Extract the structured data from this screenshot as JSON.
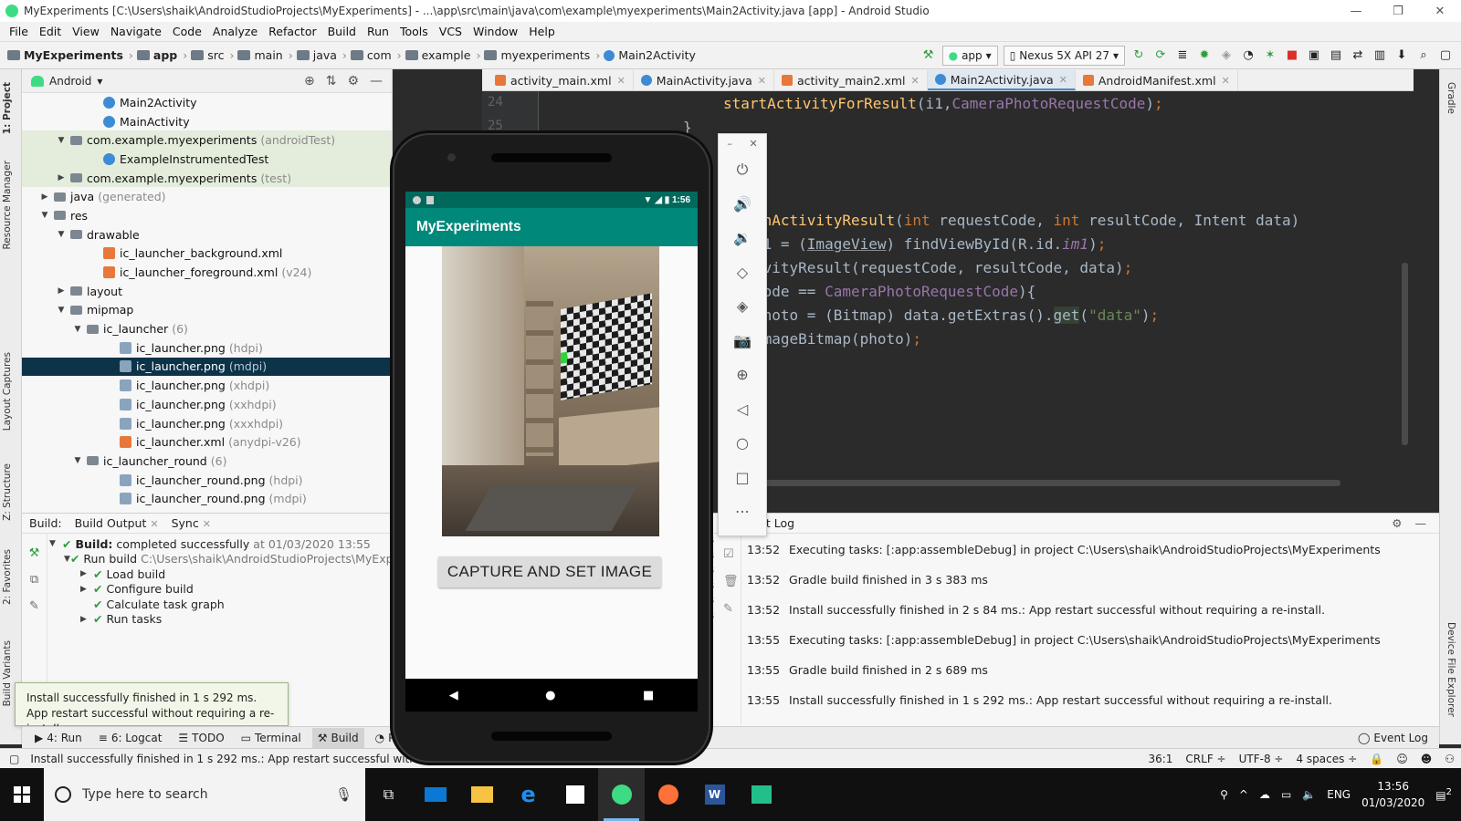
{
  "window": {
    "title": "MyExperiments [C:\\Users\\shaik\\AndroidStudioProjects\\MyExperiments] - ...\\app\\src\\main\\java\\com\\example\\myexperiments\\Main2Activity.java [app] - Android Studio",
    "controls": [
      "—",
      "❐",
      "✕"
    ]
  },
  "menu": [
    "File",
    "Edit",
    "View",
    "Navigate",
    "Code",
    "Analyze",
    "Refactor",
    "Build",
    "Run",
    "Tools",
    "VCS",
    "Window",
    "Help"
  ],
  "breadcrumbs": [
    "MyExperiments",
    "app",
    "src",
    "main",
    "java",
    "com",
    "example",
    "myexperiments",
    "Main2Activity"
  ],
  "toolbar": {
    "run_config": "app",
    "device": "Nexus 5X API 27"
  },
  "left_strip": [
    "1: Project",
    "Resource Manager",
    "Layout Captures",
    "Z: Structure",
    "2: Favorites",
    "Build Variants"
  ],
  "right_strip": [
    "Gradle",
    "Device File Explorer"
  ],
  "project": {
    "view_label": "Android",
    "rows": [
      {
        "indent": 4,
        "arrow": "",
        "icon": "cls",
        "name": "Main2Activity",
        "dim": "",
        "hl": false,
        "sel": false
      },
      {
        "indent": 4,
        "arrow": "",
        "icon": "cls",
        "name": "MainActivity",
        "dim": "",
        "hl": false,
        "sel": false
      },
      {
        "indent": 2,
        "arrow": "▼",
        "icon": "fold",
        "name": "com.example.myexperiments",
        "dim": "(androidTest)",
        "hl": true,
        "sel": false
      },
      {
        "indent": 4,
        "arrow": "",
        "icon": "cls",
        "name": "ExampleInstrumentedTest",
        "dim": "",
        "hl": true,
        "sel": false
      },
      {
        "indent": 2,
        "arrow": "▶",
        "icon": "fold",
        "name": "com.example.myexperiments",
        "dim": "(test)",
        "hl": true,
        "sel": false
      },
      {
        "indent": 1,
        "arrow": "▶",
        "icon": "fold",
        "name": "java",
        "dim": "(generated)",
        "hl": false,
        "sel": false
      },
      {
        "indent": 1,
        "arrow": "▼",
        "icon": "fold",
        "name": "res",
        "dim": "",
        "hl": false,
        "sel": false
      },
      {
        "indent": 2,
        "arrow": "▼",
        "icon": "fold",
        "name": "drawable",
        "dim": "",
        "hl": false,
        "sel": false
      },
      {
        "indent": 4,
        "arrow": "",
        "icon": "xml",
        "name": "ic_launcher_background.xml",
        "dim": "",
        "hl": false,
        "sel": false
      },
      {
        "indent": 4,
        "arrow": "",
        "icon": "xml",
        "name": "ic_launcher_foreground.xml",
        "dim": "(v24)",
        "hl": false,
        "sel": false
      },
      {
        "indent": 2,
        "arrow": "▶",
        "icon": "fold",
        "name": "layout",
        "dim": "",
        "hl": false,
        "sel": false
      },
      {
        "indent": 2,
        "arrow": "▼",
        "icon": "fold",
        "name": "mipmap",
        "dim": "",
        "hl": false,
        "sel": false
      },
      {
        "indent": 3,
        "arrow": "▼",
        "icon": "fold",
        "name": "ic_launcher",
        "dim": "(6)",
        "hl": false,
        "sel": false
      },
      {
        "indent": 5,
        "arrow": "",
        "icon": "png",
        "name": "ic_launcher.png",
        "dim": "(hdpi)",
        "hl": false,
        "sel": false
      },
      {
        "indent": 5,
        "arrow": "",
        "icon": "png",
        "name": "ic_launcher.png",
        "dim": "(mdpi)",
        "hl": false,
        "sel": true
      },
      {
        "indent": 5,
        "arrow": "",
        "icon": "png",
        "name": "ic_launcher.png",
        "dim": "(xhdpi)",
        "hl": false,
        "sel": false
      },
      {
        "indent": 5,
        "arrow": "",
        "icon": "png",
        "name": "ic_launcher.png",
        "dim": "(xxhdpi)",
        "hl": false,
        "sel": false
      },
      {
        "indent": 5,
        "arrow": "",
        "icon": "png",
        "name": "ic_launcher.png",
        "dim": "(xxxhdpi)",
        "hl": false,
        "sel": false
      },
      {
        "indent": 5,
        "arrow": "",
        "icon": "xml",
        "name": "ic_launcher.xml",
        "dim": "(anydpi-v26)",
        "hl": false,
        "sel": false
      },
      {
        "indent": 3,
        "arrow": "▼",
        "icon": "fold",
        "name": "ic_launcher_round",
        "dim": "(6)",
        "hl": false,
        "sel": false
      },
      {
        "indent": 5,
        "arrow": "",
        "icon": "png",
        "name": "ic_launcher_round.png",
        "dim": "(hdpi)",
        "hl": false,
        "sel": false
      },
      {
        "indent": 5,
        "arrow": "",
        "icon": "png",
        "name": "ic_launcher_round.png",
        "dim": "(mdpi)",
        "hl": false,
        "sel": false
      }
    ]
  },
  "editor": {
    "tabs": [
      {
        "name": "activity_main.xml",
        "type": "xml",
        "active": false
      },
      {
        "name": "MainActivity.java",
        "type": "java",
        "active": false
      },
      {
        "name": "activity_main2.xml",
        "type": "xml",
        "active": false
      },
      {
        "name": "Main2Activity.java",
        "type": "java",
        "active": true
      },
      {
        "name": "AndroidManifest.xml",
        "type": "xml",
        "active": false
      }
    ],
    "line_numbers": [
      "24",
      "25"
    ]
  },
  "build": {
    "tabs": [
      "Build:",
      "Build Output",
      "Sync"
    ],
    "status_bold": "Build:",
    "status_text": "completed successfully",
    "status_time": "at 01/03/2020 13:55",
    "run_build": "Run build",
    "run_build_path": "C:\\Users\\shaik\\AndroidStudioProjects\\MyExperi",
    "steps": [
      "Load build",
      "Configure build",
      "Calculate task graph",
      "Run tasks"
    ]
  },
  "toast": {
    "line1": "Install successfully finished in 1 s 292 ms.",
    "line2": "App restart successful without requiring a re-install."
  },
  "event_log": {
    "title": "Event Log",
    "ms_labels": [
      "ms",
      "ms",
      "ms",
      "ms",
      "ms",
      "ms"
    ],
    "entries": [
      {
        "time": "13:52",
        "text": "Executing tasks: [:app:assembleDebug] in project C:\\Users\\shaik\\AndroidStudioProjects\\MyExperiments"
      },
      {
        "time": "13:52",
        "text": "Gradle build finished in 3 s 383 ms"
      },
      {
        "time": "13:52",
        "text": "Install successfully finished in 2 s 84 ms.: App restart successful without requiring a re-install."
      },
      {
        "time": "13:55",
        "text": "Executing tasks: [:app:assembleDebug] in project C:\\Users\\shaik\\AndroidStudioProjects\\MyExperiments"
      },
      {
        "time": "13:55",
        "text": "Gradle build finished in 2 s 689 ms"
      },
      {
        "time": "13:55",
        "text": "Install successfully finished in 1 s 292 ms.: App restart successful without requiring a re-install."
      }
    ]
  },
  "bottom_tools": {
    "run": "4: Run",
    "logcat": "6: Logcat",
    "todo": "TODO",
    "terminal": "Terminal",
    "build": "Build",
    "profiler": "Pr",
    "event_log": "Event Log"
  },
  "status": {
    "message": "Install successfully finished in 1 s 292 ms.: App restart successful without requiring a re-install.",
    "position": "36:1",
    "line_sep": "CRLF ÷",
    "encoding": "UTF-8 ÷",
    "indent": "4 spaces ÷"
  },
  "phone": {
    "time": "1:56",
    "app_title": "MyExperiments",
    "button_label": "CAPTURE AND SET IMAGE"
  },
  "taskbar": {
    "search_placeholder": "Type here to search",
    "lang": "ENG",
    "time": "13:56",
    "date": "01/03/2020",
    "notifications": "2"
  },
  "colors": {
    "app_bar": "#00897b",
    "status_bar": "#00695c",
    "selection": "#0d3349",
    "editor_bg": "#2b2b2b"
  }
}
